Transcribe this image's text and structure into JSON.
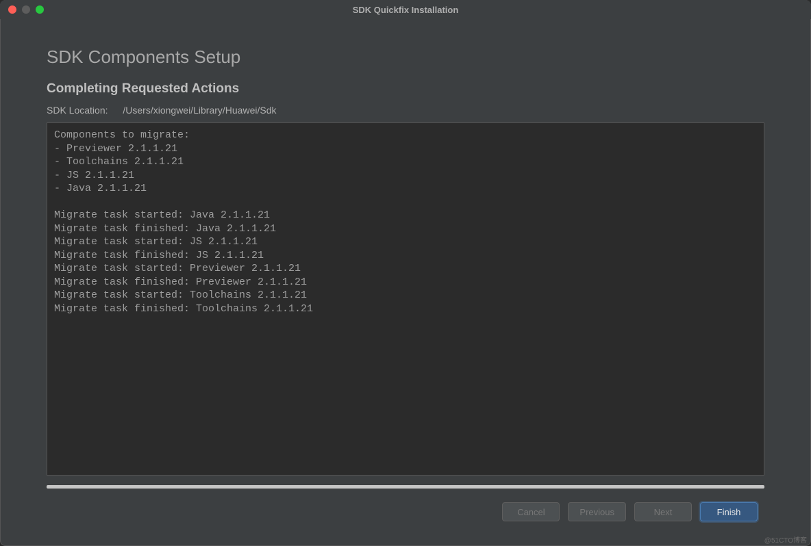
{
  "window": {
    "title": "SDK Quickfix Installation"
  },
  "heading": "SDK Components Setup",
  "subheading": "Completing Requested Actions",
  "sdk_location_label": "SDK Location:",
  "sdk_location_path": "/Users/xiongwei/Library/Huawei/Sdk",
  "log": "Components to migrate:\n- Previewer 2.1.1.21\n- Toolchains 2.1.1.21\n- JS 2.1.1.21\n- Java 2.1.1.21\n\nMigrate task started: Java 2.1.1.21\nMigrate task finished: Java 2.1.1.21\nMigrate task started: JS 2.1.1.21\nMigrate task finished: JS 2.1.1.21\nMigrate task started: Previewer 2.1.1.21\nMigrate task finished: Previewer 2.1.1.21\nMigrate task started: Toolchains 2.1.1.21\nMigrate task finished: Toolchains 2.1.1.21",
  "buttons": {
    "cancel": "Cancel",
    "previous": "Previous",
    "next": "Next",
    "finish": "Finish"
  },
  "watermark": "@51CTO博客"
}
